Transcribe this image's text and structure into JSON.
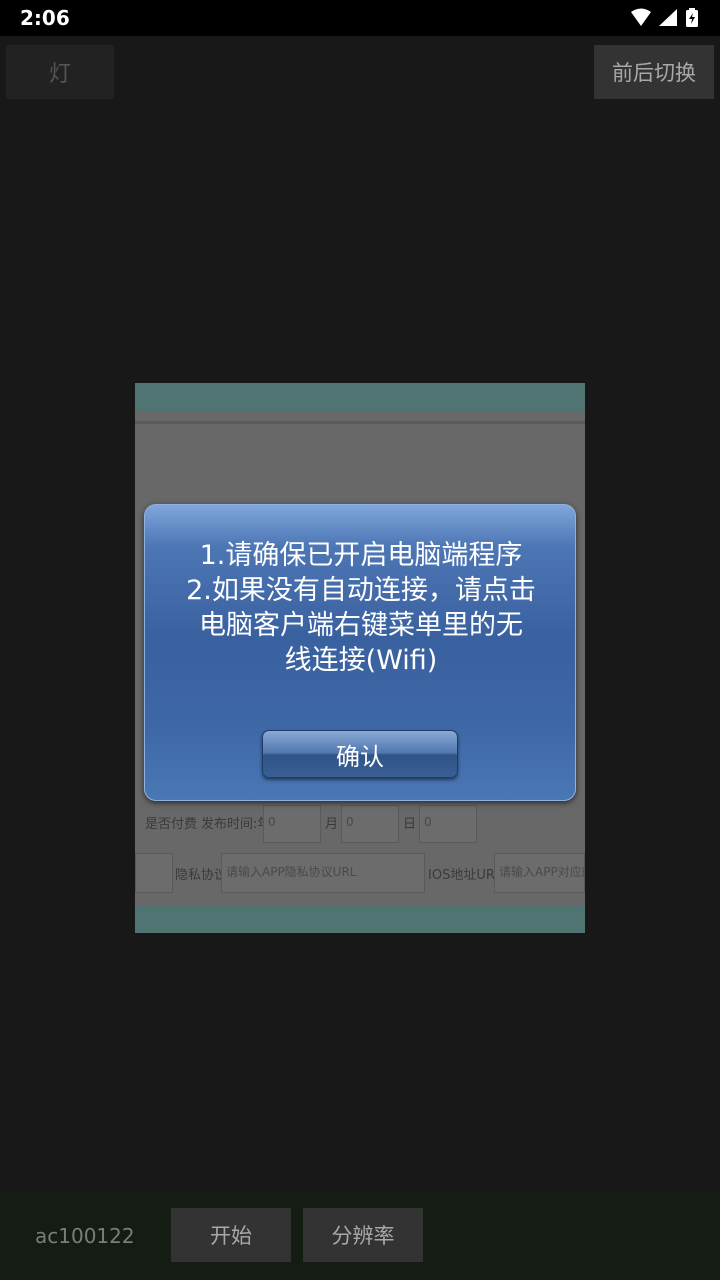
{
  "status_bar": {
    "time": "2:06",
    "icons": [
      "wifi-icon",
      "signal-icon",
      "battery-charging-icon"
    ]
  },
  "toolbar": {
    "light_label": "灯",
    "switch_label": "前后切换"
  },
  "preview": {
    "labels": {
      "paid": "是否付费",
      "release_time": "发布时间:年",
      "year_value": "0",
      "month": "月",
      "month_value": "0",
      "day": "日",
      "day_value": "0",
      "privacy": "隐私协议:",
      "privacy_placeholder": "请输入APP隐私协议URL",
      "ios_url": "IOS地址URL",
      "ios_placeholder": "请输入APP对应的"
    }
  },
  "dialog": {
    "lines": [
      "1.请确保已开启电脑端程序",
      "2.如果没有自动连接，请点击",
      "电脑客户端右键菜单里的无",
      "线连接(Wifi)"
    ],
    "confirm_label": "确认"
  },
  "bottom_bar": {
    "device_id": "ac100122",
    "start_label": "开始",
    "resolution_label": "分辨率"
  },
  "colors": {
    "background": "#181818",
    "dialog_blue": "#3a619f",
    "bottom_bar": "#141c14"
  }
}
